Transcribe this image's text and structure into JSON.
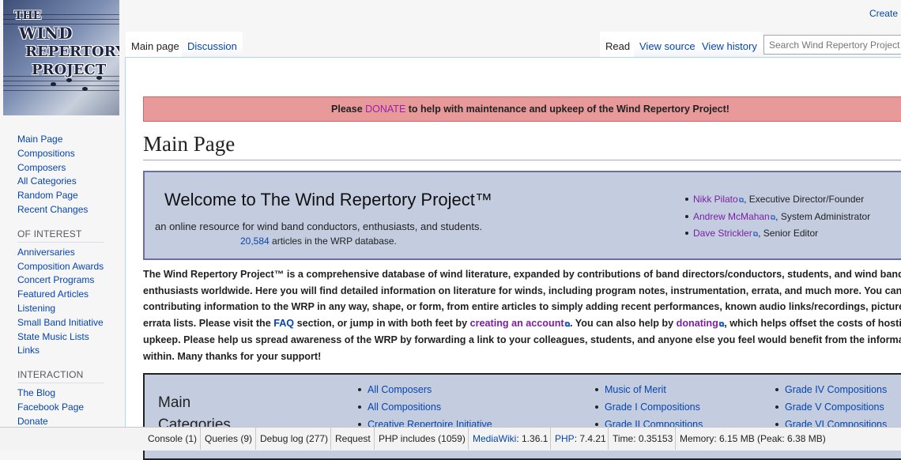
{
  "logo": {
    "line1": "THE",
    "line2": "WIND",
    "line3": "REPERTORY",
    "line4": "PROJECT"
  },
  "personal": {
    "create": "Create"
  },
  "tabs": {
    "main": "Main page",
    "discussion": "Discussion",
    "read": "Read",
    "view_source": "View source",
    "view_history": "View history"
  },
  "search": {
    "placeholder": "Search Wind Repertory Project"
  },
  "sidebar": {
    "nav": [
      "Main Page",
      "Compositions",
      "Composers",
      "All Categories",
      "Random Page",
      "Recent Changes"
    ],
    "interest_heading": "OF INTEREST",
    "interest": [
      "Anniversaries",
      "Composition Awards",
      "Concert Programs",
      "Featured Articles",
      "Listening",
      "Small Band Initiative",
      "State Music Lists",
      "Links"
    ],
    "interaction_heading": "INTERACTION",
    "interaction": [
      "The Blog",
      "Facebook Page",
      "Donate"
    ]
  },
  "donate_banner": {
    "pre": "Please ",
    "link": "DONATE",
    "post": " to help with maintenance and upkeep of the Wind Repertory Project!"
  },
  "page_title": "Main Page",
  "welcome": {
    "heading": "Welcome to The Wind Repertory Project™",
    "subtitle": "an online resource for wind band conductors, enthusiasts, and students.",
    "count": "20,584",
    "count_suffix": " articles in the WRP database."
  },
  "staff": [
    {
      "name": "Nikk Pilato",
      "role": ", Executive Director/Founder"
    },
    {
      "name": "Andrew McMahan",
      "role": ", System Administrator"
    },
    {
      "name": "Dave Strickler",
      "role": ", Senior Editor"
    }
  ],
  "intro": {
    "line1": "The Wind Repertory Project™ is a comprehensive database of wind literature, expanded by contributions of band directors/conductors, students, and wind band",
    "line2": "enthusiasts worldwide. Here you will find detailed information on literature for winds, including program notes, instrumentation, errata, and much more. You can assist by",
    "line3": "contributing information to the WRP in any way, shape, or form, from entire articles to simply adding recent performances, known audio links/recordings, pictures, or",
    "line4_a": "errata lists. Please visit the ",
    "line4_faq": "FAQ",
    "line4_b": " section, or jump in with both feet by ",
    "line4_create": "creating an account",
    "line4_c": ". You can also help by ",
    "line4_donating": "donating",
    "line4_d": ", which helps offset the costs of hosting and",
    "line5": "upkeep. Please help us spread awareness of the WRP by forwarding a link to your colleagues, students, and anyone else you feel would benefit from the information",
    "line6": "within. Many thanks for your support!"
  },
  "categories": {
    "heading": "Main Categories",
    "col1": [
      "All Composers",
      "All Compositions",
      "Creative Repertoire Initiative"
    ],
    "col2": [
      "Music of Merit",
      "Grade I Compositions",
      "Grade II Compositions"
    ],
    "col3": [
      "Grade IV Compositions",
      "Grade V Compositions",
      "Grade VI Compositions"
    ]
  },
  "debug": {
    "console": "Console (1)",
    "queries": "Queries (9)",
    "debug_log": "Debug log (277)",
    "request": "Request",
    "php_includes": "PHP includes (1059)",
    "mediawiki_label": "MediaWiki",
    "mediawiki_version": ": 1.36.1",
    "php_label": "PHP",
    "php_version": ": 7.4.21",
    "time": "Time: 0.35153",
    "memory": "Memory: 6.15 MB (Peak: 6.38 MB)"
  }
}
